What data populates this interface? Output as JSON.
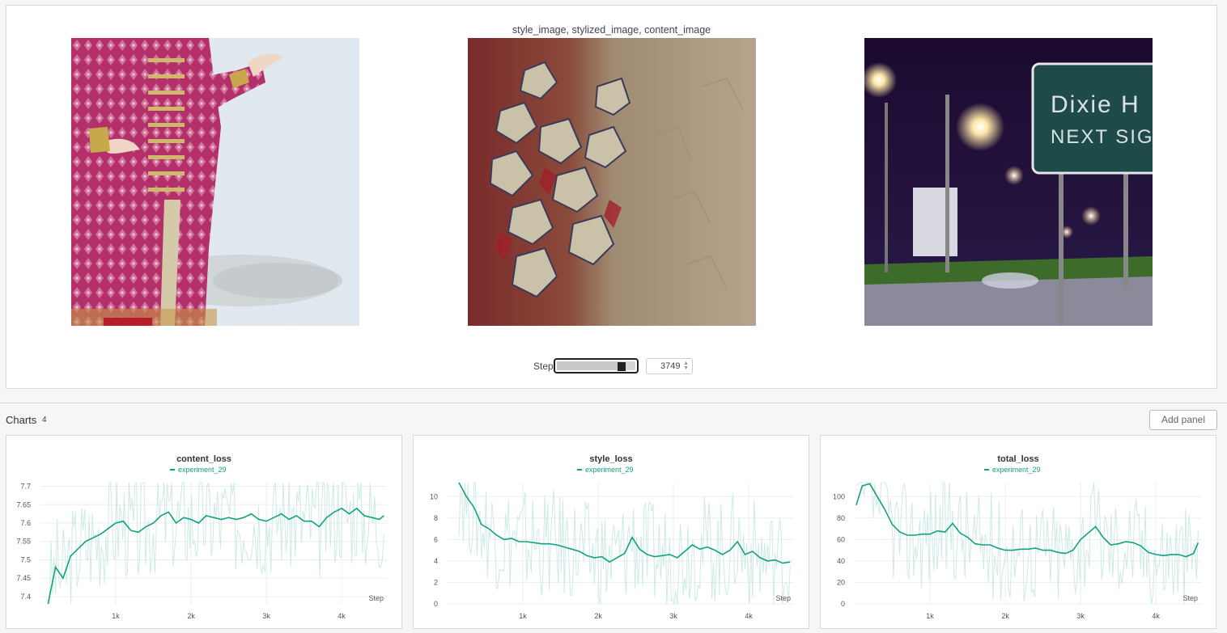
{
  "media": {
    "title": "style_image, stylized_image, content_image",
    "images": [
      {
        "name": "style-image",
        "description": "style"
      },
      {
        "name": "stylized-image",
        "description": "stylized"
      },
      {
        "name": "content-image",
        "description": "content",
        "sign_line1": "Dixie H",
        "sign_line2": "NEXT SIG"
      }
    ],
    "step_label": "Step",
    "step_value": "3749",
    "slider_fraction": 0.82
  },
  "section": {
    "title": "Charts",
    "count": "4",
    "add_panel_label": "Add panel"
  },
  "colors": {
    "series": "#13a183",
    "series_light": "#cdebe4"
  },
  "chart_data": [
    {
      "type": "line",
      "title": "content_loss",
      "legend": [
        "experiment_29"
      ],
      "xlabel": "Step",
      "xlim": [
        0,
        4600
      ],
      "ylim": [
        7.38,
        7.71
      ],
      "xticks": [
        1000,
        2000,
        3000,
        4000
      ],
      "xtick_labels": [
        "1k",
        "2k",
        "3k",
        "4k"
      ],
      "yticks": [
        7.4,
        7.45,
        7.5,
        7.55,
        7.6,
        7.65,
        7.7
      ],
      "ytick_labels": [
        "7.4",
        "7.45",
        "7.5",
        "7.55",
        "7.6",
        "7.65",
        "7.7"
      ],
      "series": [
        {
          "name": "experiment_29",
          "x": [
            100,
            200,
            300,
            400,
            500,
            600,
            700,
            800,
            900,
            1000,
            1100,
            1200,
            1300,
            1400,
            1500,
            1600,
            1700,
            1800,
            1900,
            2000,
            2100,
            2200,
            2300,
            2400,
            2500,
            2600,
            2700,
            2800,
            2900,
            3000,
            3100,
            3200,
            3300,
            3400,
            3500,
            3600,
            3700,
            3800,
            3900,
            4000,
            4100,
            4200,
            4300,
            4400,
            4500,
            4560
          ],
          "y": [
            7.38,
            7.48,
            7.45,
            7.51,
            7.53,
            7.55,
            7.56,
            7.57,
            7.585,
            7.6,
            7.605,
            7.58,
            7.575,
            7.59,
            7.6,
            7.62,
            7.63,
            7.6,
            7.615,
            7.61,
            7.6,
            7.62,
            7.615,
            7.61,
            7.615,
            7.61,
            7.615,
            7.625,
            7.61,
            7.605,
            7.615,
            7.625,
            7.61,
            7.62,
            7.605,
            7.605,
            7.59,
            7.615,
            7.63,
            7.64,
            7.625,
            7.64,
            7.62,
            7.615,
            7.61,
            7.62
          ]
        }
      ]
    },
    {
      "type": "line",
      "title": "style_loss",
      "legend": [
        "experiment_29"
      ],
      "xlabel": "Step",
      "xlim": [
        0,
        4600
      ],
      "ylim": [
        0,
        11.3
      ],
      "xticks": [
        1000,
        2000,
        3000,
        4000
      ],
      "xtick_labels": [
        "1k",
        "2k",
        "3k",
        "4k"
      ],
      "yticks": [
        0,
        2,
        4,
        6,
        8,
        10
      ],
      "ytick_labels": [
        "0",
        "2",
        "4",
        "6",
        "8",
        "10"
      ],
      "series": [
        {
          "name": "experiment_29",
          "x": [
            150,
            250,
            350,
            450,
            550,
            650,
            750,
            850,
            950,
            1050,
            1150,
            1250,
            1350,
            1450,
            1550,
            1650,
            1750,
            1850,
            1950,
            2050,
            2150,
            2250,
            2350,
            2450,
            2550,
            2650,
            2750,
            2850,
            2950,
            3050,
            3150,
            3250,
            3350,
            3450,
            3550,
            3650,
            3750,
            3850,
            3950,
            4050,
            4150,
            4250,
            4350,
            4450,
            4550
          ],
          "y": [
            11.3,
            10.0,
            9.0,
            7.4,
            7.0,
            6.4,
            6.0,
            6.1,
            5.8,
            5.8,
            5.7,
            5.6,
            5.6,
            5.5,
            5.3,
            5.1,
            4.9,
            4.5,
            4.3,
            4.4,
            3.9,
            4.3,
            4.7,
            6.2,
            5.1,
            4.6,
            4.4,
            4.5,
            4.6,
            4.3,
            4.9,
            5.5,
            5.1,
            5.3,
            5.0,
            4.6,
            5.0,
            5.8,
            4.6,
            4.9,
            4.3,
            4.0,
            4.1,
            3.8,
            3.9
          ]
        }
      ]
    },
    {
      "type": "line",
      "title": "total_loss",
      "legend": [
        "experiment_29"
      ],
      "xlabel": "Step",
      "xlim": [
        0,
        4600
      ],
      "ylim": [
        0,
        113
      ],
      "xticks": [
        1000,
        2000,
        3000,
        4000
      ],
      "xtick_labels": [
        "1k",
        "2k",
        "3k",
        "4k"
      ],
      "yticks": [
        0,
        20,
        40,
        60,
        80,
        100
      ],
      "ytick_labels": [
        "0",
        "20",
        "40",
        "60",
        "80",
        "100"
      ],
      "series": [
        {
          "name": "experiment_29",
          "x": [
            20,
            100,
            200,
            300,
            400,
            500,
            600,
            700,
            800,
            900,
            1000,
            1100,
            1200,
            1300,
            1400,
            1500,
            1600,
            1700,
            1800,
            1900,
            2000,
            2100,
            2200,
            2300,
            2400,
            2500,
            2600,
            2700,
            2800,
            2900,
            3000,
            3100,
            3200,
            3300,
            3400,
            3500,
            3600,
            3700,
            3800,
            3900,
            4000,
            4100,
            4200,
            4300,
            4400,
            4500,
            4560
          ],
          "y": [
            92,
            110,
            112,
            100,
            88,
            74,
            67,
            64,
            64,
            65,
            65,
            68,
            67,
            75,
            66,
            62,
            56,
            55,
            55,
            52,
            50,
            50,
            51,
            51,
            52,
            50,
            50,
            48,
            47,
            50,
            60,
            66,
            72,
            62,
            55,
            56,
            58,
            57,
            54,
            48,
            46,
            45,
            46,
            46,
            44,
            47,
            57
          ]
        }
      ]
    }
  ]
}
